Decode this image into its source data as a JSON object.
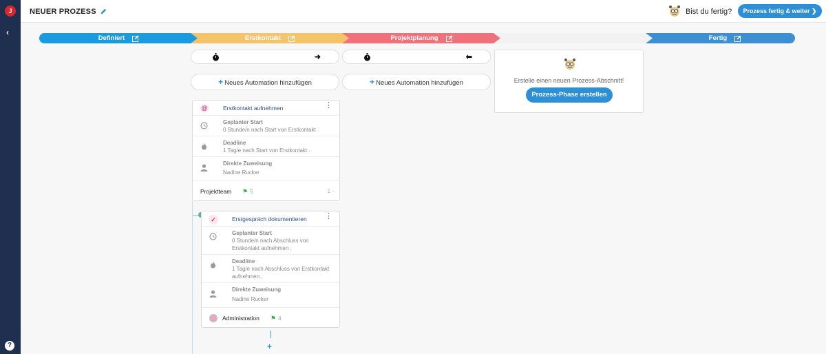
{
  "sidebar": {
    "logo": "J",
    "toggle": "‹",
    "help": "?"
  },
  "header": {
    "title": "NEUER PROZESS",
    "question": "Bist du fertig?",
    "done_button": "Prozess fertig & weiter ❯"
  },
  "stages": [
    {
      "label": "Definiert",
      "color": "#1a9be0"
    },
    {
      "label": "Erstkontakt",
      "color": "#f5c46a"
    },
    {
      "label": "Projektplanung",
      "color": "#f0717a"
    },
    {
      "label": "",
      "color": "#f2f2f2"
    },
    {
      "label": "Fertig",
      "color": "#3d8fd3"
    }
  ],
  "automation": {
    "arrow_right": "➜",
    "arrow_left": "⬅",
    "add_label": "Neues Automation hinzufügen",
    "plus": "+"
  },
  "new_phase": {
    "text": "Erstelle einen neuen Prozess-Abschnitt!",
    "button": "Prozess-Phase erstellen"
  },
  "cards": [
    {
      "title": "Erstkontakt aufnehmen",
      "start_label": "Geplanter Start",
      "start_value": "0 Stunde/n nach Start von Erstkontakt .",
      "deadline_label": "Deadline",
      "deadline_value": "1 Tag/e nach Start von Erstkontakt .",
      "assign_label": "Direkte Zuweisung",
      "assign_value": "Nadine Rucker",
      "team": "Projektteam",
      "flag_count": "5",
      "right_count": "1 -"
    },
    {
      "title": "Erstgespräch dokumentieren",
      "start_label": "Geplanter Start",
      "start_value": "0 Stunde/n nach Abschluss von Erstkontakt aufnehmen .",
      "deadline_label": "Deadline",
      "deadline_value": "1 Tag/e nach Abschluss von Erstkontakt aufnehmen .",
      "assign_label": "Direkte Zuweisung",
      "assign_value": "Nadine Rucker",
      "team": "Administration",
      "flag_count": "4"
    }
  ],
  "add_step": "+",
  "colors": {
    "accent": "#2e8fd9",
    "sidebar": "#1e2f4f",
    "flag": "#3aaa4d"
  }
}
